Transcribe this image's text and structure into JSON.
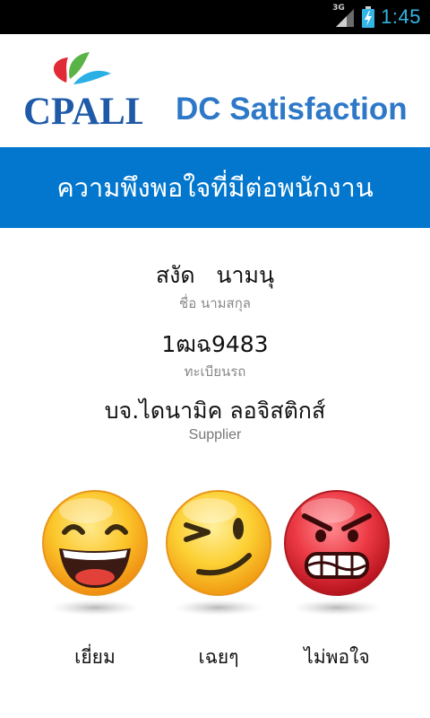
{
  "status_bar": {
    "time": "1:45",
    "network": "3G",
    "icons": [
      "signal-icon",
      "battery-charging-icon"
    ]
  },
  "header": {
    "logo_text": "CPALL",
    "title": "DC Satisfaction"
  },
  "banner": {
    "text": "ความพึงพอใจที่มีต่อพนักงาน"
  },
  "employee": {
    "name": "สงัด   นามนุ",
    "name_caption": "ชื่อ นามสกุล",
    "plate": "1ฒฉ9483",
    "plate_caption": "ทะเบียนรถ",
    "supplier": "บจ.ไดนามิค ลอจิสติกส์",
    "supplier_caption": "Supplier"
  },
  "ratings": [
    {
      "label": "เยี่ยม",
      "icon": "laughing-face-icon",
      "color": "#f7a81b"
    },
    {
      "label": "เฉยๆ",
      "icon": "winking-face-icon",
      "color": "#f7b51b"
    },
    {
      "label": "ไม่พอใจ",
      "icon": "angry-face-icon",
      "color": "#e8343f"
    }
  ],
  "colors": {
    "banner": "#0277cd",
    "title": "#2e78c8",
    "clock": "#33b5e5"
  }
}
